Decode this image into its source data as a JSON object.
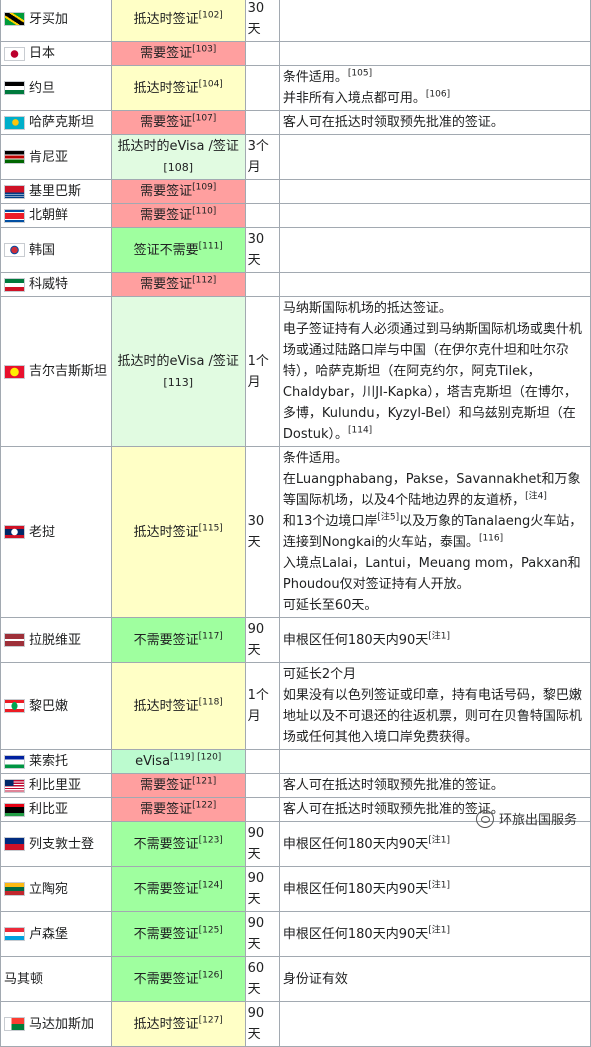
{
  "colors": {
    "visa_required": "#ff9f9f",
    "visa_on_arrival": "#ffffc6",
    "evisa_on_arrival": "#e1fbe1",
    "visa_free": "#9fff9f",
    "evisa": "#bcfbcf",
    "border": "#a2a9b1"
  },
  "rows": [
    {
      "country": "牙买加",
      "flag": "flag-jamaica-icon",
      "visa": "抵达时签证",
      "ref": "[102]",
      "duration": "30天",
      "note_lines": []
    },
    {
      "country": "日本",
      "flag": "flag-japan-icon",
      "visa": "需要签证",
      "ref": "[103]",
      "duration": "",
      "note_lines": []
    },
    {
      "country": "约旦",
      "flag": "flag-jordan-icon",
      "visa": "抵达时签证",
      "ref": "[104]",
      "duration": "",
      "note_lines": [
        "条件适用。",
        "并非所有入境点都可用。"
      ],
      "note_refs": [
        "[105]",
        "[106]"
      ]
    },
    {
      "country": "哈萨克斯坦",
      "flag": "flag-kazakhstan-icon",
      "visa": "需要签证",
      "ref": "[107]",
      "duration": "",
      "note_lines": [
        "客人可在抵达时领取预先批准的签证。"
      ]
    },
    {
      "country": "肯尼亚",
      "flag": "flag-kenya-icon",
      "visa": "抵达时的eVisa /签证",
      "ref": "[108]",
      "duration": "3个月",
      "note_lines": []
    },
    {
      "country": "基里巴斯",
      "flag": "flag-kiribati-icon",
      "visa": "需要签证",
      "ref": "[109]",
      "duration": "",
      "note_lines": []
    },
    {
      "country": "北朝鲜",
      "flag": "flag-north-korea-icon",
      "visa": "需要签证",
      "ref": "[110]",
      "duration": "",
      "note_lines": []
    },
    {
      "country": "韩国",
      "flag": "flag-south-korea-icon",
      "visa": "签证不需要",
      "ref": "[111]",
      "duration": "30天",
      "note_lines": []
    },
    {
      "country": "科威特",
      "flag": "flag-kuwait-icon",
      "visa": "需要签证",
      "ref": "[112]",
      "duration": "",
      "note_lines": []
    },
    {
      "country": "吉尔吉斯斯坦",
      "flag": "flag-kyrgyzstan-icon",
      "visa": "抵达时的eVisa /签证",
      "ref": "[113]",
      "duration": "1个月",
      "note_lines": [
        "马纳斯国际机场的抵达签证。",
        "电子签证持有人必须通过到马纳斯国际机场或奥什机场或通过陆路口岸与中国（在伊尔克什坦和吐尔尕特），哈萨克斯坦（在阿克约尔，阿克Tilek，Chaldybar，川JI-Kapka），塔吉克斯坦（在博尔，多博，Kulundu，Kyzyl-Bel）和乌兹别克斯坦（在Dostuk）。"
      ],
      "note_refs": [
        "",
        "[114]"
      ]
    },
    {
      "country": "老挝",
      "flag": "flag-laos-icon",
      "visa": "抵达时签证",
      "ref": "[115]",
      "duration": "30天",
      "note_lines": [
        "条件适用。",
        "在Luangphabang，Pakse，Savannakhet和万象等国际机场，以及4个陆地边界的友道桥，",
        "和13个边境口岸",
        "以及万象的Tanalaeng火车站，连接到Nongkai的火车站，泰国。",
        "入境点Lalai，Lantui，Meuang mom，Pakxan和Phoudou仅对签证持有人开放。",
        "可延长至60天。"
      ],
      "note_refs": [
        "",
        "[注4]",
        "[注5]",
        "[116]",
        "",
        ""
      ]
    },
    {
      "country": "拉脱维亚",
      "flag": "flag-latvia-icon",
      "visa": "不需要签证",
      "ref": "[117]",
      "duration": "90天",
      "note_lines": [
        "申根区任何180天内90天"
      ],
      "note_refs": [
        "[注1]"
      ]
    },
    {
      "country": "黎巴嫩",
      "flag": "flag-lebanon-icon",
      "visa": "抵达时签证",
      "ref": "[118]",
      "duration": "1个月",
      "note_lines": [
        "可延长2个月",
        "如果没有以色列签证或印章，持有电话号码，黎巴嫩地址以及不可退还的往返机票，则可在贝鲁特国际机场或任何其他入境口岸免费获得。"
      ]
    },
    {
      "country": "莱索托",
      "flag": "flag-lesotho-icon",
      "visa": "eVisa",
      "ref": "[119] [120]",
      "duration": "",
      "note_lines": []
    },
    {
      "country": "利比里亚",
      "flag": "flag-liberia-icon",
      "visa": "需要签证",
      "ref": "[121]",
      "duration": "",
      "note_lines": [
        "客人可在抵达时领取预先批准的签证。"
      ]
    },
    {
      "country": "利比亚",
      "flag": "flag-libya-icon",
      "visa": "需要签证",
      "ref": "[122]",
      "duration": "",
      "note_lines": [
        "客人可在抵达时领取预先批准的签证。"
      ]
    },
    {
      "country": "列支敦士登",
      "flag": "flag-liechtenstein-icon",
      "visa": "不需要签证",
      "ref": "[123]",
      "duration": "90天",
      "note_lines": [
        "申根区任何180天内90天"
      ],
      "note_refs": [
        "[注1]"
      ]
    },
    {
      "country": "立陶宛",
      "flag": "flag-lithuania-icon",
      "visa": "不需要签证",
      "ref": "[124]",
      "duration": "90天",
      "note_lines": [
        "申根区任何180天内90天"
      ],
      "note_refs": [
        "[注1]"
      ]
    },
    {
      "country": "卢森堡",
      "flag": "flag-luxembourg-icon",
      "visa": "不需要签证",
      "ref": "[125]",
      "duration": "90天",
      "note_lines": [
        "申根区任何180天内90天"
      ],
      "note_refs": [
        "[注1]"
      ]
    },
    {
      "country": "马其顿",
      "flag": "",
      "visa": "不需要签证",
      "ref": "[126]",
      "duration": "60天",
      "note_lines": [
        "身份证有效"
      ]
    },
    {
      "country": "马达加斯加",
      "flag": "flag-madagascar-icon",
      "visa": "抵达时签证",
      "ref": "[127]",
      "duration": "90天",
      "note_lines": []
    }
  ],
  "watermark": {
    "text": "环旅出国服务",
    "icon": "wechat-icon"
  }
}
